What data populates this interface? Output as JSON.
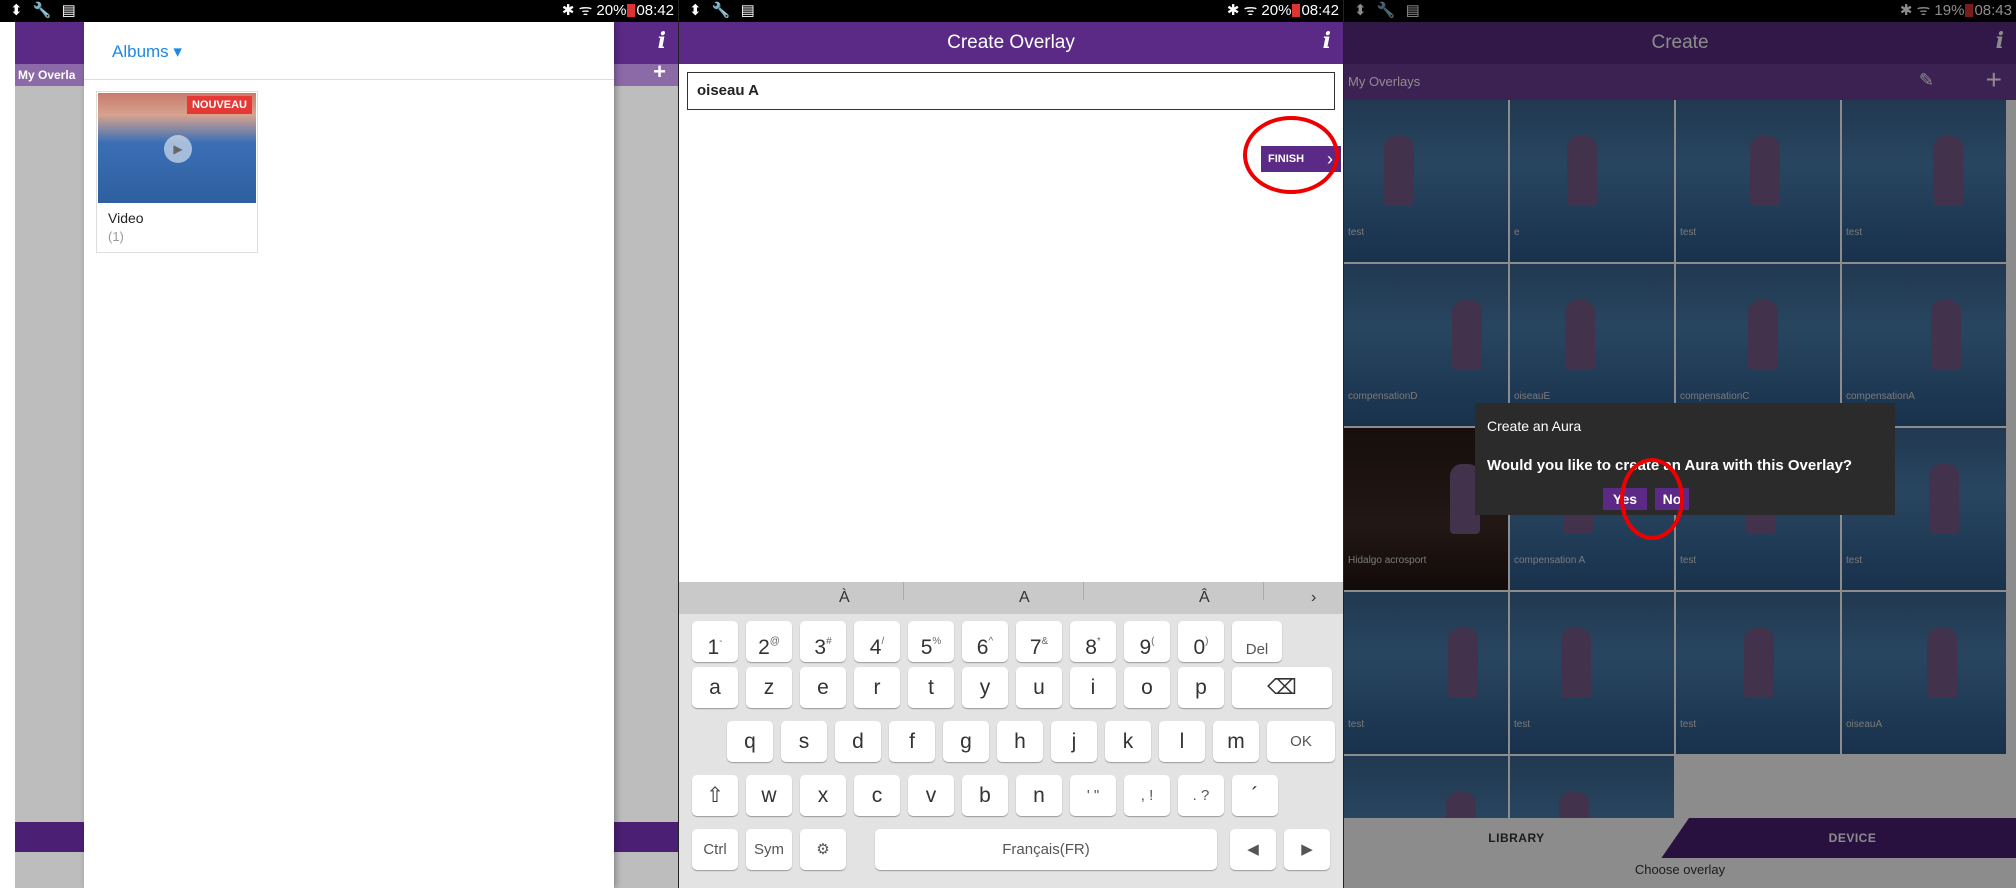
{
  "panel1": {
    "status": {
      "icons": "⬍ 🔧 ▤",
      "right": "✱ ᯤ 20%",
      "time": "08:42"
    },
    "bg_label": "My Overla",
    "albums_label": "Albums ▾",
    "album": {
      "badge": "NOUVEAU",
      "name": "Video",
      "count": "(1)"
    }
  },
  "panel2": {
    "status": {
      "icons": "⬍ 🔧 ▤",
      "right": "✱ ᯤ 20%",
      "time": "08:42"
    },
    "title": "Create Overlay",
    "info": "i",
    "input_value": "oiseau A",
    "finish_label": "FINISH",
    "suggestions": [
      "À",
      "A",
      "Â",
      "›"
    ],
    "keys_row1": [
      "1",
      "2",
      "3",
      "4",
      "5",
      "6",
      "7",
      "8",
      "9",
      "0",
      "Del"
    ],
    "keys_row1_sup": [
      "-",
      "@",
      "#",
      "/",
      "%",
      "^",
      "&",
      "*",
      "(",
      ")",
      ""
    ],
    "keys_row2": [
      "a",
      "z",
      "e",
      "r",
      "t",
      "y",
      "u",
      "i",
      "o",
      "p",
      "⌫"
    ],
    "keys_row3": [
      "q",
      "s",
      "d",
      "f",
      "g",
      "h",
      "j",
      "k",
      "l",
      "m",
      "OK"
    ],
    "keys_row4": [
      "⇧",
      "w",
      "x",
      "c",
      "v",
      "b",
      "n",
      "' \"",
      ", !",
      ". ?",
      "´"
    ],
    "keys_row5": [
      "Ctrl",
      "Sym",
      "⚙",
      "Français(FR)",
      "◀",
      "▶"
    ]
  },
  "panel3": {
    "status": {
      "icons": "⬍ 🔧 ▤",
      "right": "✱ ᯤ 19%",
      "time": "08:43"
    },
    "title": "Create",
    "info": "i",
    "my_overlays": "My Overlays",
    "tiles": [
      "test",
      "e",
      "test",
      "test",
      "compensationD",
      "oiseauE",
      "compensationC",
      "compensationA",
      "Hidalgo acrosport",
      "compensation A",
      "test",
      "test",
      "test",
      "test",
      "test",
      "oiseauA",
      "",
      ""
    ],
    "tabs": {
      "library": "LIBRARY",
      "device": "DEVICE"
    },
    "choose": "Choose overlay",
    "dialog": {
      "title": "Create an Aura",
      "message": "Would you like to create an Aura with this Overlay?",
      "yes": "Yes",
      "no": "No"
    }
  },
  "colors": {
    "brand_purple": "#5b2a86",
    "link_blue": "#1e88e5",
    "highlight_red": "#e00000"
  }
}
